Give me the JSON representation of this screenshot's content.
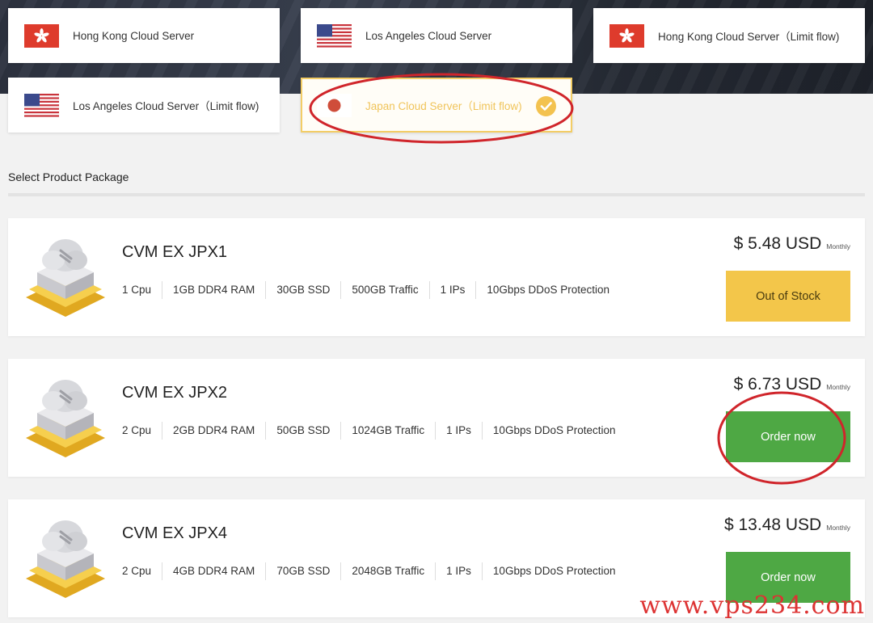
{
  "regions": [
    {
      "label": "Hong Kong Cloud Server",
      "flag": "hk-flag-icon",
      "selected": false
    },
    {
      "label": "Los Angeles Cloud Server",
      "flag": "us-flag-icon",
      "selected": false
    },
    {
      "label": "Hong Kong Cloud Server（Limit flow)",
      "flag": "hk-flag-icon",
      "selected": false
    },
    {
      "label": "Los Angeles Cloud Server（Limit flow)",
      "flag": "us-flag-icon",
      "selected": false
    },
    {
      "label": "Japan Cloud Server（Limit flow)",
      "flag": "jp-flag-icon",
      "selected": true
    }
  ],
  "section_title": "Select Product Package",
  "packages": [
    {
      "name": "CVM EX JPX1",
      "specs": [
        "1 Cpu",
        "1GB DDR4 RAM",
        "30GB SSD",
        "500GB Traffic",
        "1 IPs",
        "10Gbps DDoS Protection"
      ],
      "price": "$ 5.48 USD",
      "cycle": "Monthly",
      "button": "Out of Stock",
      "status": "out-of-stock"
    },
    {
      "name": "CVM EX JPX2",
      "specs": [
        "2 Cpu",
        "2GB DDR4 RAM",
        "50GB SSD",
        "1024GB Traffic",
        "1 IPs",
        "10Gbps DDoS Protection"
      ],
      "price": "$ 6.73 USD",
      "cycle": "Monthly",
      "button": "Order now",
      "status": "available"
    },
    {
      "name": "CVM EX JPX4",
      "specs": [
        "2 Cpu",
        "4GB DDR4 RAM",
        "70GB SSD",
        "2048GB Traffic",
        "1 IPs",
        "10Gbps DDoS Protection"
      ],
      "price": "$ 13.48 USD",
      "cycle": "Monthly",
      "button": "Order now",
      "status": "available"
    }
  ],
  "watermark": "www.vps234.com",
  "colors": {
    "selected_border": "#f3cd66",
    "out_of_stock": "#f3c64a",
    "order": "#4ea844",
    "annotation": "#d0252b"
  }
}
